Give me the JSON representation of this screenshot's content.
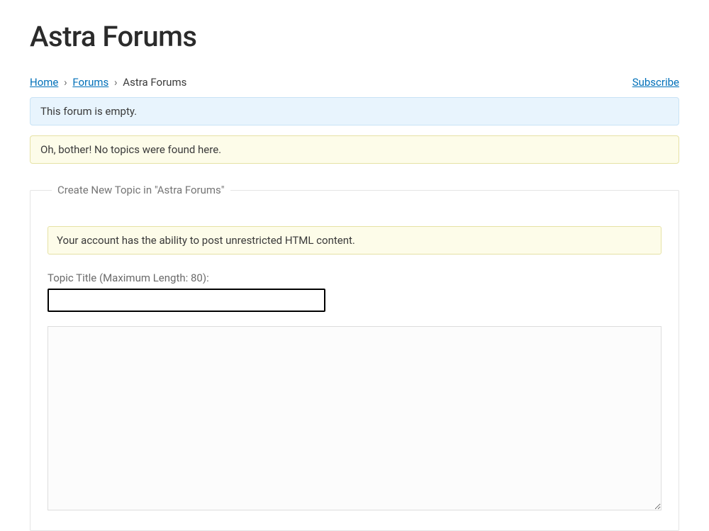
{
  "header": {
    "title": "Astra Forums"
  },
  "breadcrumb": {
    "home": "Home",
    "forums": "Forums",
    "current": "Astra Forums",
    "sep": "›"
  },
  "actions": {
    "subscribe": "Subscribe"
  },
  "notices": {
    "empty": "This forum is empty.",
    "no_topics": "Oh, bother! No topics were found here."
  },
  "form": {
    "legend": "Create New Topic in \"Astra Forums\"",
    "html_notice": "Your account has the ability to post unrestricted HTML content.",
    "title_label": "Topic Title (Maximum Length: 80):",
    "title_value": "",
    "body_value": ""
  }
}
